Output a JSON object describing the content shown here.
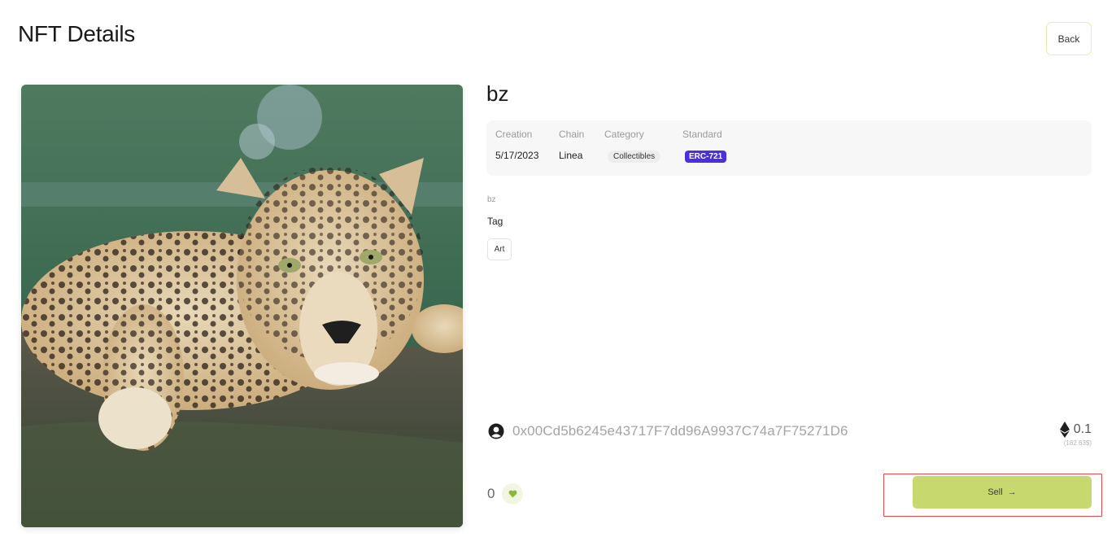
{
  "header": {
    "title": "NFT Details",
    "back_label": "Back"
  },
  "nft": {
    "image_icon": "leopard-photo",
    "name": "bz",
    "info": {
      "creation_label": "Creation",
      "creation_value": "5/17/2023",
      "chain_label": "Chain",
      "chain_value": "Linea",
      "category_label": "Category",
      "category_value": "Collectibles",
      "standard_label": "Standard",
      "standard_value": "ERC-721"
    },
    "description": "bz",
    "tag_heading": "Tag",
    "tags": [
      "Art"
    ],
    "owner_address": "0x00Cd5b6245e43717F7dd96A9937C74a7F75271D6",
    "price": "0.1",
    "price_usd": "(182.63$)",
    "likes": "0"
  },
  "actions": {
    "sell_label": "Sell",
    "sell_arrow": "→"
  },
  "colors": {
    "accent": "#c7d86e",
    "standard_badge": "#4c2ee0",
    "highlight": "#e44a4a"
  }
}
